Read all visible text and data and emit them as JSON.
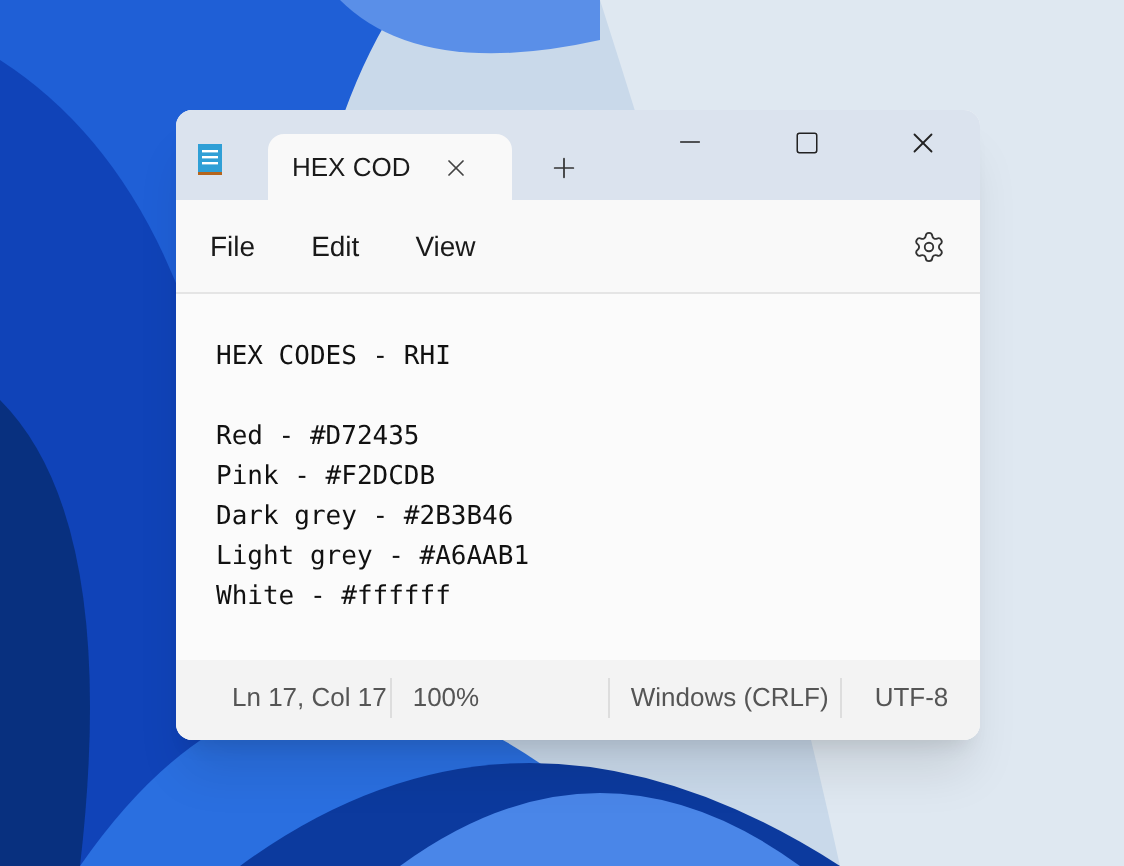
{
  "tabs": [
    {
      "label": "HEX COD",
      "selected": true
    }
  ],
  "menu": [
    "File",
    "Edit",
    "View"
  ],
  "editor": {
    "paragraphs": [
      [
        "HEX CODES - RHI"
      ],
      [
        "Red - #D72435",
        "Pink - #F2DCDB",
        "Dark grey - #2B3B46",
        "Light grey - #A6AAB1",
        "White - #ffffff"
      ]
    ]
  },
  "status_bar": [
    "Ln 17, Col 17",
    "100%",
    "Windows (CRLF)",
    "UTF-8"
  ]
}
